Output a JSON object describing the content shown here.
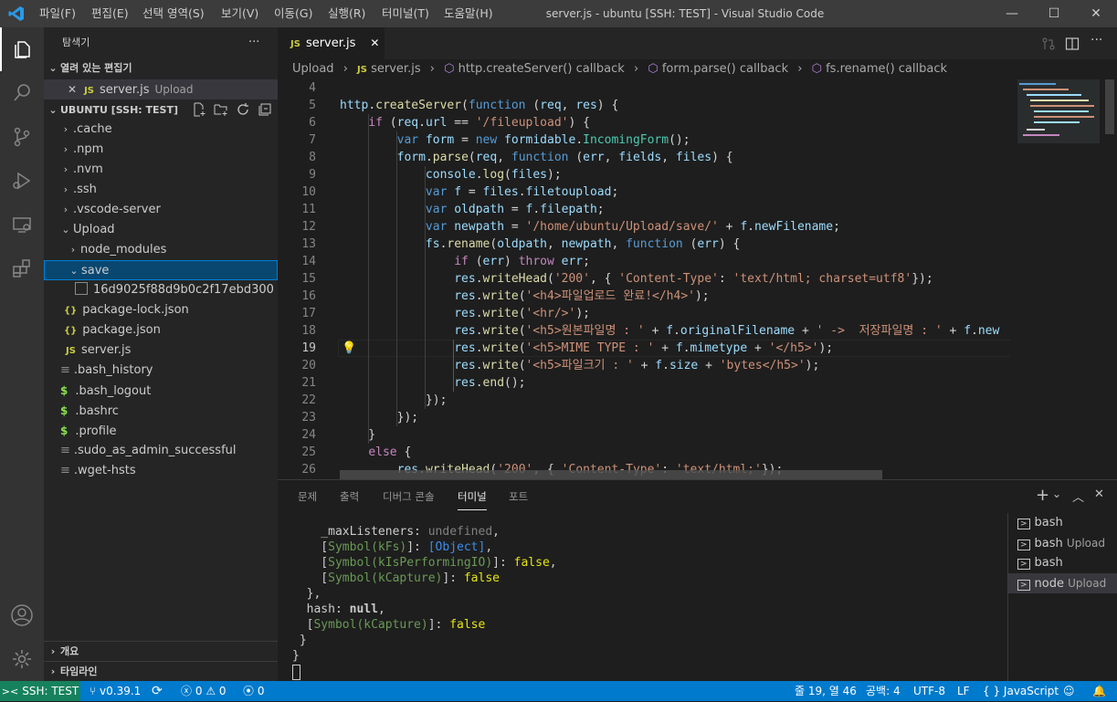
{
  "titlebar": {
    "menus": [
      "파일(F)",
      "편집(E)",
      "선택 영역(S)",
      "보기(V)",
      "이동(G)",
      "실행(R)",
      "터미널(T)",
      "도움말(H)"
    ],
    "title": "server.js - ubuntu [SSH: TEST] - Visual Studio Code",
    "minimize": "—",
    "maximize": "☐",
    "close": "✕"
  },
  "sidebar": {
    "header": "탐색기",
    "more": "···",
    "open_editors": "열려 있는 편집기",
    "open_file": {
      "name": "server.js",
      "dir": "Upload",
      "icon_text": "JS",
      "close": "✕"
    },
    "workspace": "UBUNTU [SSH: TEST]",
    "tree": [
      {
        "label": ".cache"
      },
      {
        "label": ".npm"
      },
      {
        "label": ".nvm"
      },
      {
        "label": ".ssh"
      },
      {
        "label": ".vscode-server"
      },
      {
        "label": "Upload"
      },
      {
        "label": "node_modules"
      },
      {
        "label": "save"
      },
      {
        "label": "16d9025f88d9b0c2f17ebd300"
      },
      {
        "label": "package-lock.json",
        "icon": "{}"
      },
      {
        "label": "package.json",
        "icon": "{}"
      },
      {
        "label": "server.js",
        "icon": "JS"
      },
      {
        "label": ".bash_history"
      },
      {
        "label": ".bash_logout",
        "icon": "$"
      },
      {
        "label": ".bashrc",
        "icon": "$"
      },
      {
        "label": ".profile",
        "icon": "$"
      },
      {
        "label": ".sudo_as_admin_successful"
      },
      {
        "label": ".wget-hsts"
      }
    ],
    "outline": "개요",
    "timeline": "타임라인"
  },
  "editor": {
    "tab": {
      "icon": "JS",
      "label": "server.js",
      "close": "✕"
    },
    "breadcrumb": [
      "Upload",
      "server.js",
      "http.createServer() callback",
      "form.parse() callback",
      "fs.rename() callback"
    ],
    "line_numbers": [
      "4",
      "5",
      "6",
      "7",
      "8",
      "9",
      "10",
      "11",
      "12",
      "13",
      "14",
      "15",
      "16",
      "17",
      "18",
      "19",
      "20",
      "21",
      "22",
      "23",
      "24",
      "25",
      "26"
    ],
    "current_line": "19"
  },
  "panel": {
    "tabs": [
      "문제",
      "출력",
      "디버그 콘솔",
      "터미널",
      "포트"
    ],
    "active_tab": "터미널",
    "terminal_lines": [
      "    _maxListeners: undefined,",
      "    [Symbol(kFs)]: [Object],",
      "    [Symbol(kIsPerformingIO)]: false,",
      "    [Symbol(kCapture)]: false",
      "  },",
      "  hash: null,",
      "  [Symbol(kCapture)]: false",
      " }",
      "}"
    ],
    "terminals": [
      {
        "name": "bash",
        "sub": ""
      },
      {
        "name": "bash",
        "sub": "Upload"
      },
      {
        "name": "bash",
        "sub": ""
      },
      {
        "name": "node",
        "sub": "Upload"
      }
    ]
  },
  "status": {
    "remote": "SSH: TEST",
    "branch": "v0.39.1",
    "errors": "0",
    "warnings": "0",
    "ports": "0",
    "position": "줄 19, 열 46",
    "spaces": "공백: 4",
    "encoding": "UTF-8",
    "eol": "LF",
    "language": "JavaScript",
    "language_icon": "{ }"
  },
  "colors": {
    "accent": "#007acc",
    "remote": "#16825d",
    "selection": "#094771"
  }
}
